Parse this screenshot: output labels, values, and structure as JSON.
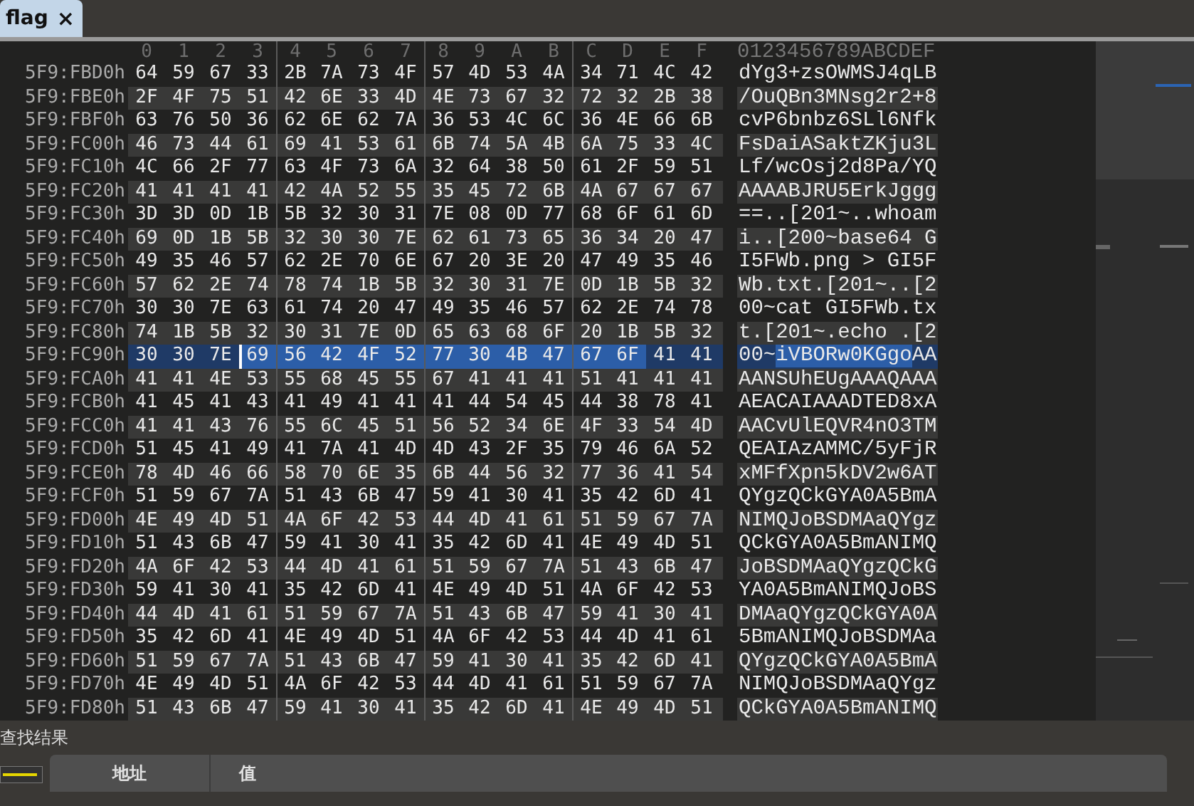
{
  "tabs": [
    {
      "label": "flag",
      "close": "×",
      "selected": true
    }
  ],
  "hex_view": {
    "column_headers": [
      "0",
      "1",
      "2",
      "3",
      "4",
      "5",
      "6",
      "7",
      "8",
      "9",
      "A",
      "B",
      "C",
      "D",
      "E",
      "F"
    ],
    "ascii_header": "0123456789ABCDEF",
    "rows": [
      {
        "offset": "5F9:FBD0h",
        "selected": false,
        "bytes": [
          "64",
          "59",
          "67",
          "33",
          "2B",
          "7A",
          "73",
          "4F",
          "57",
          "4D",
          "53",
          "4A",
          "34",
          "71",
          "4C",
          "42"
        ],
        "ascii": "dYg3+zsOWMSJ4qLB"
      },
      {
        "offset": "5F9:FBE0h",
        "selected": false,
        "bytes": [
          "2F",
          "4F",
          "75",
          "51",
          "42",
          "6E",
          "33",
          "4D",
          "4E",
          "73",
          "67",
          "32",
          "72",
          "32",
          "2B",
          "38"
        ],
        "ascii": "/OuQBn3MNsg2r2+8"
      },
      {
        "offset": "5F9:FBF0h",
        "selected": false,
        "bytes": [
          "63",
          "76",
          "50",
          "36",
          "62",
          "6E",
          "62",
          "7A",
          "36",
          "53",
          "4C",
          "6C",
          "36",
          "4E",
          "66",
          "6B"
        ],
        "ascii": "cvP6bnbz6SLl6Nfk"
      },
      {
        "offset": "5F9:FC00h",
        "selected": false,
        "bytes": [
          "46",
          "73",
          "44",
          "61",
          "69",
          "41",
          "53",
          "61",
          "6B",
          "74",
          "5A",
          "4B",
          "6A",
          "75",
          "33",
          "4C"
        ],
        "ascii": "FsDaiASaktZKju3L"
      },
      {
        "offset": "5F9:FC10h",
        "selected": false,
        "bytes": [
          "4C",
          "66",
          "2F",
          "77",
          "63",
          "4F",
          "73",
          "6A",
          "32",
          "64",
          "38",
          "50",
          "61",
          "2F",
          "59",
          "51"
        ],
        "ascii": "Lf/wcOsj2d8Pa/YQ"
      },
      {
        "offset": "5F9:FC20h",
        "selected": false,
        "bytes": [
          "41",
          "41",
          "41",
          "41",
          "42",
          "4A",
          "52",
          "55",
          "35",
          "45",
          "72",
          "6B",
          "4A",
          "67",
          "67",
          "67"
        ],
        "ascii": "AAAABJRU5ErkJggg"
      },
      {
        "offset": "5F9:FC30h",
        "selected": false,
        "bytes": [
          "3D",
          "3D",
          "0D",
          "1B",
          "5B",
          "32",
          "30",
          "31",
          "7E",
          "08",
          "0D",
          "77",
          "68",
          "6F",
          "61",
          "6D"
        ],
        "ascii": "==..[201~..whoam"
      },
      {
        "offset": "5F9:FC40h",
        "selected": false,
        "bytes": [
          "69",
          "0D",
          "1B",
          "5B",
          "32",
          "30",
          "30",
          "7E",
          "62",
          "61",
          "73",
          "65",
          "36",
          "34",
          "20",
          "47"
        ],
        "ascii": "i..[200~base64 G"
      },
      {
        "offset": "5F9:FC50h",
        "selected": false,
        "bytes": [
          "49",
          "35",
          "46",
          "57",
          "62",
          "2E",
          "70",
          "6E",
          "67",
          "20",
          "3E",
          "20",
          "47",
          "49",
          "35",
          "46"
        ],
        "ascii": "I5FWb.png > GI5F"
      },
      {
        "offset": "5F9:FC60h",
        "selected": false,
        "bytes": [
          "57",
          "62",
          "2E",
          "74",
          "78",
          "74",
          "1B",
          "5B",
          "32",
          "30",
          "31",
          "7E",
          "0D",
          "1B",
          "5B",
          "32"
        ],
        "ascii": "Wb.txt.[201~..[2"
      },
      {
        "offset": "5F9:FC70h",
        "selected": false,
        "bytes": [
          "30",
          "30",
          "7E",
          "63",
          "61",
          "74",
          "20",
          "47",
          "49",
          "35",
          "46",
          "57",
          "62",
          "2E",
          "74",
          "78"
        ],
        "ascii": "00~cat GI5FWb.tx"
      },
      {
        "offset": "5F9:FC80h",
        "selected": false,
        "bytes": [
          "74",
          "1B",
          "5B",
          "32",
          "30",
          "31",
          "7E",
          "0D",
          "65",
          "63",
          "68",
          "6F",
          "20",
          "1B",
          "5B",
          "32"
        ],
        "ascii": "t.[201~.echo .[2"
      },
      {
        "offset": "5F9:FC90h",
        "selected": true,
        "bytes": [
          "30",
          "30",
          "7E"
        ],
        "selected_bytes": [
          "69",
          "56",
          "42",
          "4F",
          "52",
          "77",
          "30",
          "4B",
          "47",
          "67",
          "6F"
        ],
        "bytes_after": [
          "41",
          "41"
        ],
        "ascii": "00~",
        "selected_ascii": "iVBORw0KGgo",
        "ascii_after": "AA"
      },
      {
        "offset": "5F9:FCA0h",
        "selected": false,
        "bytes": [
          "41",
          "41",
          "4E",
          "53",
          "55",
          "68",
          "45",
          "55",
          "67",
          "41",
          "41",
          "41",
          "51",
          "41",
          "41",
          "41"
        ],
        "ascii": "AANSUhEUgAAAQAAA"
      },
      {
        "offset": "5F9:FCB0h",
        "selected": false,
        "bytes": [
          "41",
          "45",
          "41",
          "43",
          "41",
          "49",
          "41",
          "41",
          "41",
          "44",
          "54",
          "45",
          "44",
          "38",
          "78",
          "41"
        ],
        "ascii": "AEACAIAAADTED8xA"
      },
      {
        "offset": "5F9:FCC0h",
        "selected": false,
        "bytes": [
          "41",
          "41",
          "43",
          "76",
          "55",
          "6C",
          "45",
          "51",
          "56",
          "52",
          "34",
          "6E",
          "4F",
          "33",
          "54",
          "4D"
        ],
        "ascii": "AACvUlEQVR4nO3TM"
      },
      {
        "offset": "5F9:FCD0h",
        "selected": false,
        "bytes": [
          "51",
          "45",
          "41",
          "49",
          "41",
          "7A",
          "41",
          "4D",
          "4D",
          "43",
          "2F",
          "35",
          "79",
          "46",
          "6A",
          "52"
        ],
        "ascii": "QEAIAzAMMC/5yFjR"
      },
      {
        "offset": "5F9:FCE0h",
        "selected": false,
        "bytes": [
          "78",
          "4D",
          "46",
          "66",
          "58",
          "70",
          "6E",
          "35",
          "6B",
          "44",
          "56",
          "32",
          "77",
          "36",
          "41",
          "54"
        ],
        "ascii": "xMFfXpn5kDV2w6AT"
      },
      {
        "offset": "5F9:FCF0h",
        "selected": false,
        "bytes": [
          "51",
          "59",
          "67",
          "7A",
          "51",
          "43",
          "6B",
          "47",
          "59",
          "41",
          "30",
          "41",
          "35",
          "42",
          "6D",
          "41"
        ],
        "ascii": "QYgzQCkGYA0A5BmA"
      },
      {
        "offset": "5F9:FD00h",
        "selected": false,
        "bytes": [
          "4E",
          "49",
          "4D",
          "51",
          "4A",
          "6F",
          "42",
          "53",
          "44",
          "4D",
          "41",
          "61",
          "51",
          "59",
          "67",
          "7A"
        ],
        "ascii": "NIMQJoBSDMAaQYgz"
      },
      {
        "offset": "5F9:FD10h",
        "selected": false,
        "bytes": [
          "51",
          "43",
          "6B",
          "47",
          "59",
          "41",
          "30",
          "41",
          "35",
          "42",
          "6D",
          "41",
          "4E",
          "49",
          "4D",
          "51"
        ],
        "ascii": "QCkGYA0A5BmANIMQ"
      },
      {
        "offset": "5F9:FD20h",
        "selected": false,
        "bytes": [
          "4A",
          "6F",
          "42",
          "53",
          "44",
          "4D",
          "41",
          "61",
          "51",
          "59",
          "67",
          "7A",
          "51",
          "43",
          "6B",
          "47"
        ],
        "ascii": "JoBSDMAaQYgzQCkG"
      },
      {
        "offset": "5F9:FD30h",
        "selected": false,
        "bytes": [
          "59",
          "41",
          "30",
          "41",
          "35",
          "42",
          "6D",
          "41",
          "4E",
          "49",
          "4D",
          "51",
          "4A",
          "6F",
          "42",
          "53"
        ],
        "ascii": "YA0A5BmANIMQJoBS"
      },
      {
        "offset": "5F9:FD40h",
        "selected": false,
        "bytes": [
          "44",
          "4D",
          "41",
          "61",
          "51",
          "59",
          "67",
          "7A",
          "51",
          "43",
          "6B",
          "47",
          "59",
          "41",
          "30",
          "41"
        ],
        "ascii": "DMAaQYgzQCkGYA0A"
      },
      {
        "offset": "5F9:FD50h",
        "selected": false,
        "bytes": [
          "35",
          "42",
          "6D",
          "41",
          "4E",
          "49",
          "4D",
          "51",
          "4A",
          "6F",
          "42",
          "53",
          "44",
          "4D",
          "41",
          "61"
        ],
        "ascii": "5BmANIMQJoBSDMAa"
      },
      {
        "offset": "5F9:FD60h",
        "selected": false,
        "bytes": [
          "51",
          "59",
          "67",
          "7A",
          "51",
          "43",
          "6B",
          "47",
          "59",
          "41",
          "30",
          "41",
          "35",
          "42",
          "6D",
          "41"
        ],
        "ascii": "QYgzQCkGYA0A5BmA"
      },
      {
        "offset": "5F9:FD70h",
        "selected": false,
        "bytes": [
          "4E",
          "49",
          "4D",
          "51",
          "4A",
          "6F",
          "42",
          "53",
          "44",
          "4D",
          "41",
          "61",
          "51",
          "59",
          "67",
          "7A"
        ],
        "ascii": "NIMQJoBSDMAaQYgz"
      },
      {
        "offset": "5F9:FD80h",
        "selected": false,
        "bytes": [
          "51",
          "43",
          "6B",
          "47",
          "59",
          "41",
          "30",
          "41",
          "35",
          "42",
          "6D",
          "41",
          "4E",
          "49",
          "4D",
          "51"
        ],
        "ascii": "QCkGYA0A5BmANIMQ"
      }
    ]
  },
  "search_results": {
    "title": "查找结果",
    "columns": [
      "地址",
      "值"
    ]
  }
}
